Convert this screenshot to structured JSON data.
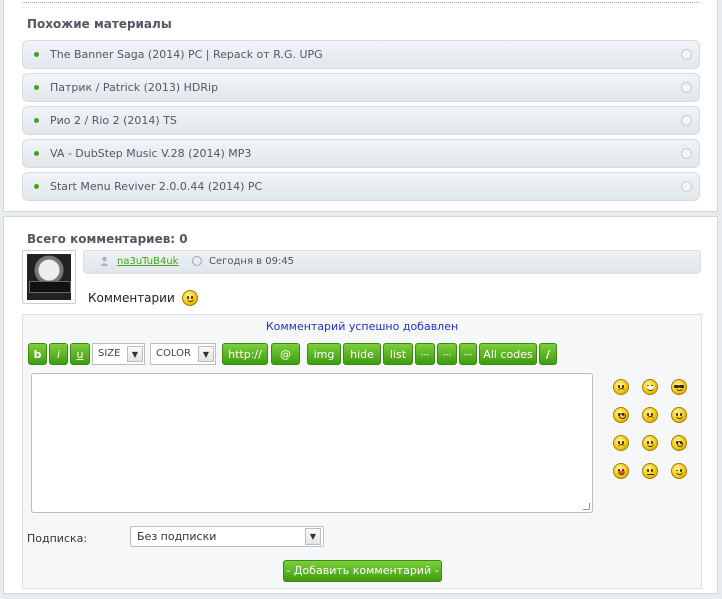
{
  "similar": {
    "title": "Похожие материалы",
    "items": [
      "The Banner Saga (2014) PC | Repack от R.G. UPG",
      "Патрик / Patrick (2013) HDRip",
      "Рио 2 / Rio 2 (2014) TS",
      "VA - DubStep Music V.28 (2014) MP3",
      "Start Menu Reviver 2.0.0.44 (2014) PC"
    ]
  },
  "comments": {
    "title": "Всего комментариев: 0",
    "comment": {
      "author": "na3uTuB4uk",
      "time": "Сегодня в 09:45",
      "text": "Комментарии"
    },
    "form": {
      "success_message": "Комментарий успешно добавлен",
      "toolbar": {
        "bold": "b",
        "italic": "i",
        "underline": "u",
        "size": "SIZE",
        "color": "COLOR",
        "http": "http://",
        "email": "@",
        "img": "img",
        "hide": "hide",
        "list": "list",
        "ext1": "---",
        "ext2": "---",
        "ext3": "---",
        "all_codes": "All codes",
        "close": "/"
      },
      "subscription_label": "Подписка:",
      "subscription_value": "Без подписки",
      "submit_label": "- Добавить комментарий -",
      "smilies": [
        "angry-smiley-icon",
        "laugh-smiley-icon",
        "cool-smiley-icon",
        "shocked-smiley-icon",
        "cry-smiley-icon",
        "smile-smiley-icon",
        "sad-smiley-icon",
        "happy-smiley-icon",
        "surprised-smiley-icon",
        "tongue-smiley-icon",
        "confused-smiley-icon",
        "wink-smiley-icon"
      ]
    }
  },
  "colors": {
    "accent_green": "#3e9b11",
    "link_green": "#48a21c",
    "success_blue": "#2233bb"
  }
}
